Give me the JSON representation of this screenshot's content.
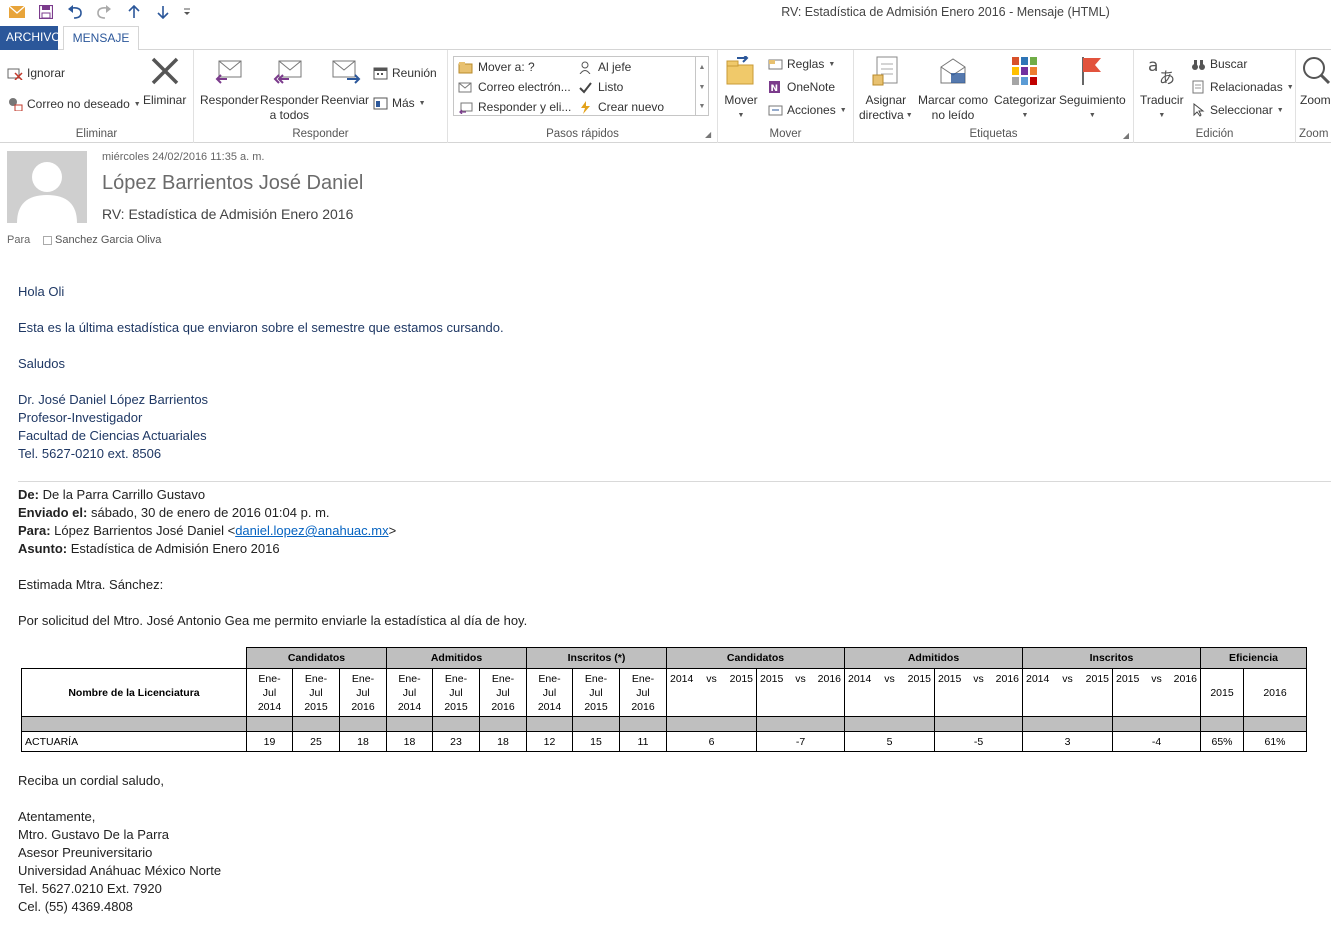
{
  "window": {
    "title": "RV: Estadística de Admisión Enero 2016 - Mensaje (HTML)"
  },
  "tabs": [
    {
      "label": "ARCHIVO"
    },
    {
      "label": "MENSAJE"
    }
  ],
  "ribbon": {
    "eliminar": {
      "label": "Eliminar",
      "ignorar": "Ignorar",
      "correo_no_deseado": "Correo no deseado",
      "eliminar_btn": "Eliminar"
    },
    "responder": {
      "label": "Responder",
      "responder_btn": "Responder",
      "responder_todos_1": "Responder",
      "responder_todos_2": "a todos",
      "reenviar": "Reenviar",
      "reunion": "Reunión",
      "mas": "Más"
    },
    "pasos_rapidos": {
      "label": "Pasos rápidos",
      "items": [
        "Mover a: ?",
        "Correo electrón...",
        "Responder y eli...",
        "Al jefe",
        "Listo",
        "Crear nuevo"
      ]
    },
    "mover": {
      "label": "Mover",
      "mover_btn": "Mover",
      "reglas": "Reglas",
      "onenote": "OneNote",
      "acciones": "Acciones"
    },
    "etiquetas": {
      "label": "Etiquetas",
      "asignar_1": "Asignar",
      "asignar_2": "directiva",
      "marcar_1": "Marcar como",
      "marcar_2": "no leído",
      "categorizar": "Categorizar",
      "seguimiento": "Seguimiento"
    },
    "edicion": {
      "label": "Edición",
      "traducir": "Traducir",
      "buscar": "Buscar",
      "relacionadas": "Relacionadas",
      "seleccionar": "Seleccionar"
    },
    "zoom": {
      "label": "Zoom",
      "zoom_btn": "Zoom"
    }
  },
  "header": {
    "date": "miércoles 24/02/2016 11:35 a. m.",
    "sender": "López Barrientos José Daniel",
    "subject": "RV: Estadística de Admisión Enero 2016",
    "to_label": "Para",
    "to_name": "Sanchez Garcia Oliva"
  },
  "body": {
    "greeting": "Hola Oli",
    "line1": "Esta es la última estadística que enviaron sobre el semestre que estamos cursando.",
    "saludos": "Saludos",
    "sig": [
      "Dr. José Daniel López Barrientos",
      "Profesor-Investigador",
      "Facultad de Ciencias Actuariales",
      "Tel. 5627-0210 ext. 8506"
    ],
    "fwd": {
      "de_label": "De:",
      "de": "De la Parra Carrillo Gustavo",
      "enviado_label": "Enviado el:",
      "enviado": "sábado, 30 de enero de 2016 01:04 p. m.",
      "para_label": "Para:",
      "para": "López Barrientos José Daniel <",
      "para_email": "daniel.lopez@anahuac.mx",
      "para_end": ">",
      "asunto_label": "Asunto:",
      "asunto": "Estadística de Admisión Enero 2016"
    },
    "estimada": "Estimada Mtra. Sánchez:",
    "solicitud": "Por solicitud del Mtro. José Antonio Gea me permito enviarle la estadística al día de hoy.",
    "cordial": "Reciba un cordial saludo,",
    "closing": [
      "Atentamente,",
      "Mtro. Gustavo De la Parra",
      "Asesor Preuniversitario",
      "Universidad Anáhuac México Norte",
      "Tel. 5627.0210 Ext. 7920",
      "Cel. (55) 4369.4808"
    ]
  },
  "table": {
    "name_header": "Nombre de la Licenciatura",
    "groups": [
      "Candidatos",
      "Admitidos",
      "Inscritos (*)",
      "Candidatos",
      "Admitidos",
      "Inscritos",
      "Eficiencia"
    ],
    "periods": [
      "Ene-\nJul\n2014",
      "Ene-\nJul\n2015",
      "Ene-\nJul\n2016"
    ],
    "vs": [
      [
        "2014",
        "vs",
        "2015"
      ],
      [
        "2015",
        "vs",
        "2016"
      ]
    ],
    "eff_years": [
      "2015",
      "2016"
    ],
    "row": {
      "name": "ACTUARÍA",
      "cells": [
        "19",
        "25",
        "18",
        "18",
        "23",
        "18",
        "12",
        "15",
        "11",
        "6",
        "-7",
        "5",
        "-5",
        "3",
        "-4",
        "65%",
        "61%"
      ]
    }
  }
}
